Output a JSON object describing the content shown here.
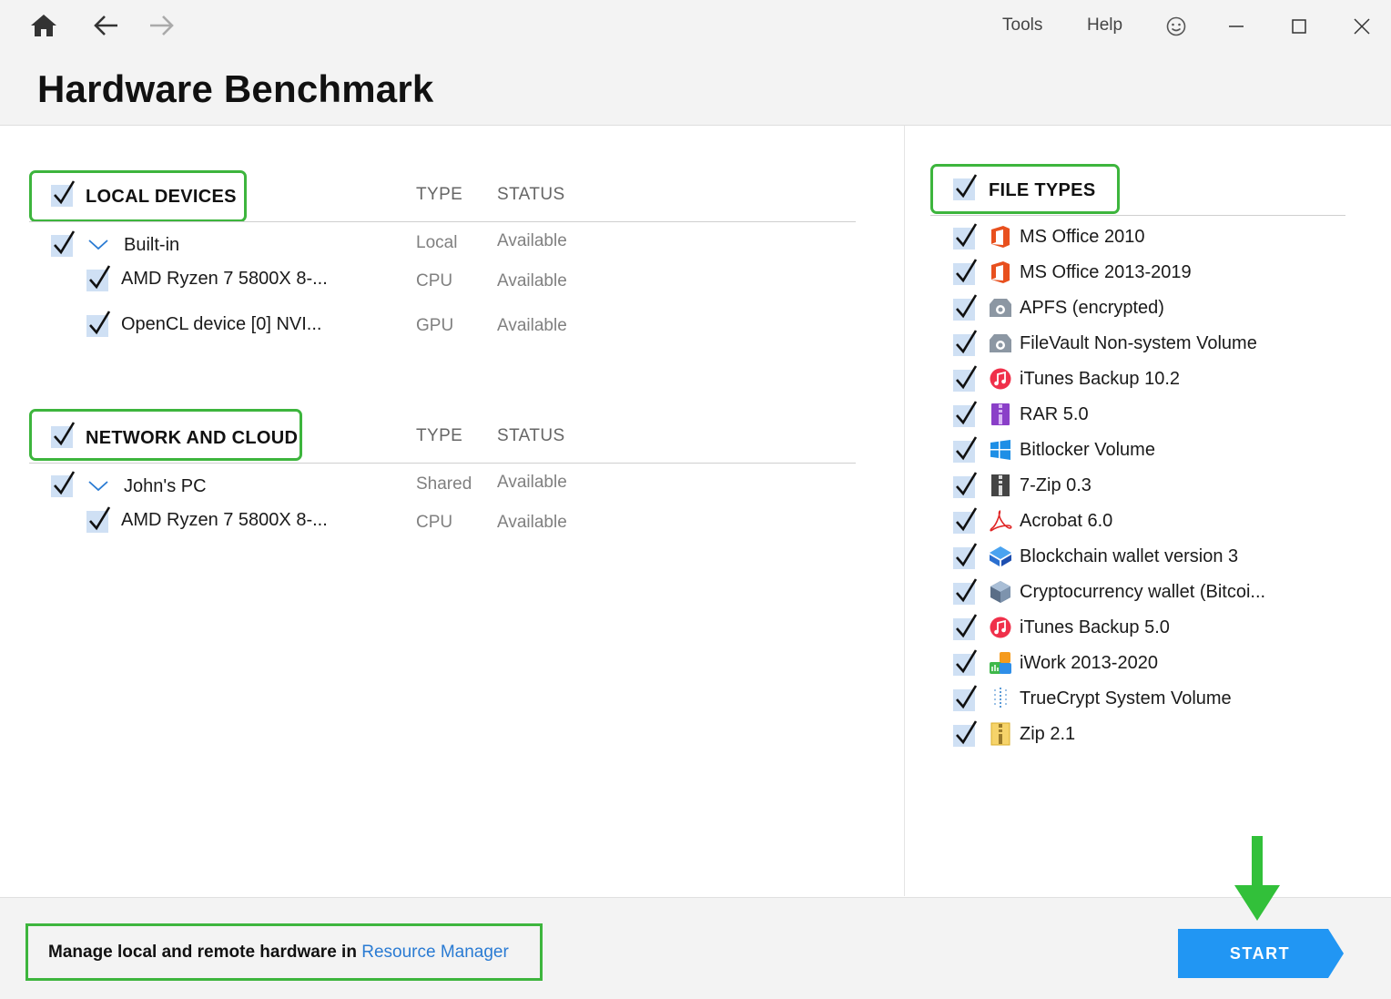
{
  "window": {
    "menu": {
      "tools": "Tools",
      "help": "Help"
    },
    "icons": [
      "home-icon",
      "back-icon",
      "forward-icon",
      "smiley-icon",
      "minimize-icon",
      "maximize-icon",
      "close-icon"
    ]
  },
  "page": {
    "title": "Hardware Benchmark"
  },
  "local_devices": {
    "title": "LOCAL DEVICES",
    "col_type": "TYPE",
    "col_status": "STATUS",
    "group": {
      "name": "Built-in",
      "type": "Local",
      "status": "Available"
    },
    "items": [
      {
        "name": "AMD Ryzen 7 5800X 8-...",
        "type": "CPU",
        "status": "Available"
      },
      {
        "name": "OpenCL device [0] NVI...",
        "type": "GPU",
        "status": "Available"
      }
    ]
  },
  "network": {
    "title": "NETWORK AND CLOUD",
    "col_type": "TYPE",
    "col_status": "STATUS",
    "group": {
      "name": "John's PC",
      "type": "Shared",
      "status": "Available"
    },
    "items": [
      {
        "name": "AMD Ryzen 7 5800X 8-...",
        "type": "CPU",
        "status": "Available"
      }
    ]
  },
  "file_types": {
    "title": "FILE TYPES",
    "items": [
      {
        "label": "MS Office 2010",
        "icon": "ms-office-icon"
      },
      {
        "label": "MS Office 2013-2019",
        "icon": "ms-office-icon"
      },
      {
        "label": "APFS (encrypted)",
        "icon": "disk-icon"
      },
      {
        "label": "FileVault Non-system Volume",
        "icon": "disk-icon"
      },
      {
        "label": "iTunes Backup 10.2",
        "icon": "itunes-icon"
      },
      {
        "label": "RAR 5.0",
        "icon": "rar-icon"
      },
      {
        "label": "Bitlocker Volume",
        "icon": "windows-icon"
      },
      {
        "label": "7-Zip 0.3",
        "icon": "7zip-icon"
      },
      {
        "label": "Acrobat 6.0",
        "icon": "acrobat-icon"
      },
      {
        "label": "Blockchain wallet version 3",
        "icon": "blockchain-icon"
      },
      {
        "label": "Cryptocurrency wallet (Bitcoi...",
        "icon": "crypto-wallet-icon"
      },
      {
        "label": "iTunes Backup 5.0",
        "icon": "itunes-icon"
      },
      {
        "label": "iWork 2013-2020",
        "icon": "iwork-icon"
      },
      {
        "label": "TrueCrypt System Volume",
        "icon": "truecrypt-icon"
      },
      {
        "label": "Zip 2.1",
        "icon": "zip-icon"
      }
    ]
  },
  "footer": {
    "manage_text": "Manage local and remote hardware in",
    "manage_link": "Resource Manager",
    "start_label": "START"
  },
  "colors": {
    "highlight_green": "#3db53d",
    "start_blue": "#2196f3",
    "link_blue": "#2a7bd3",
    "checkbox_bg": "#cfe0f4"
  }
}
